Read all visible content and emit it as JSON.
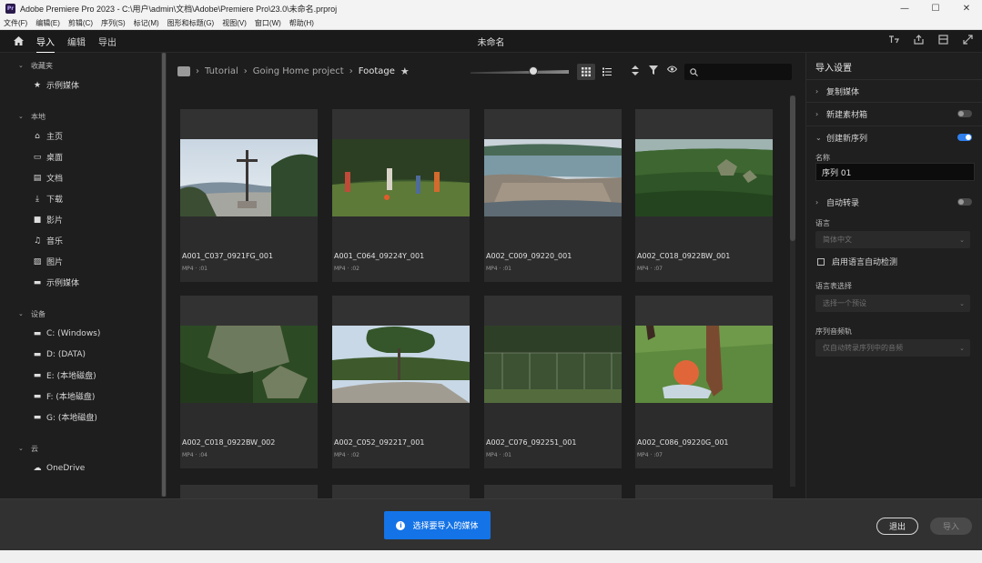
{
  "window": {
    "app_logo": "Pr",
    "title": "Adobe Premiere Pro 2023 - C:\\用户\\admin\\文档\\Adobe\\Premiere Pro\\23.0\\未命名.prproj",
    "minimize": "—",
    "maximize": "☐",
    "close": "✕"
  },
  "menu": [
    "文件(F)",
    "编辑(E)",
    "剪辑(C)",
    "序列(S)",
    "标记(M)",
    "图形和标题(G)",
    "视图(V)",
    "窗口(W)",
    "帮助(H)"
  ],
  "topbar": {
    "tabs": [
      {
        "label": "导入",
        "active": true
      },
      {
        "label": "编辑",
        "active": false
      },
      {
        "label": "导出",
        "active": false
      }
    ],
    "project_title": "未命名"
  },
  "sidebar": {
    "sections": [
      {
        "title": "收藏夹",
        "items": [
          {
            "icon": "star-icon",
            "label": "示例媒体"
          }
        ]
      },
      {
        "title": "本地",
        "items": [
          {
            "icon": "home-icon",
            "label": "主页"
          },
          {
            "icon": "desktop-icon",
            "label": "桌面"
          },
          {
            "icon": "document-icon",
            "label": "文档"
          },
          {
            "icon": "download-icon",
            "label": "下载"
          },
          {
            "icon": "video-icon",
            "label": "影片"
          },
          {
            "icon": "music-icon",
            "label": "音乐"
          },
          {
            "icon": "picture-icon",
            "label": "图片"
          },
          {
            "icon": "folder-icon",
            "label": "示例媒体"
          }
        ]
      },
      {
        "title": "设备",
        "items": [
          {
            "icon": "folder-icon",
            "label": "C: (Windows)"
          },
          {
            "icon": "folder-icon",
            "label": "D: (DATA)"
          },
          {
            "icon": "folder-icon",
            "label": "E: (本地磁盘)"
          },
          {
            "icon": "folder-icon",
            "label": "F: (本地磁盘)"
          },
          {
            "icon": "folder-icon",
            "label": "G: (本地磁盘)"
          }
        ]
      },
      {
        "title": "云",
        "items": [
          {
            "icon": "cloud-icon",
            "label": "OneDrive"
          }
        ]
      }
    ]
  },
  "browser": {
    "breadcrumb": [
      "Tutorial",
      "Going Home project",
      "Footage"
    ],
    "clips": [
      {
        "name": "A001_C037_0921FG_001",
        "meta": "MP4 · :01",
        "scene": "cross"
      },
      {
        "name": "A001_C064_09224Y_001",
        "meta": "MP4 · :02",
        "scene": "soccer"
      },
      {
        "name": "A002_C009_09220_001",
        "meta": "MP4 · :01",
        "scene": "town"
      },
      {
        "name": "A002_C018_0922BW_001",
        "meta": "MP4 · :07",
        "scene": "jungle"
      },
      {
        "name": "A002_C018_0922BW_002",
        "meta": "MP4 · :04",
        "scene": "ruins"
      },
      {
        "name": "A002_C052_092217_001",
        "meta": "MP4 · :02",
        "scene": "tree"
      },
      {
        "name": "A002_C076_092251_001",
        "meta": "MP4 · :01",
        "scene": "field"
      },
      {
        "name": "A002_C086_09220G_001",
        "meta": "MP4 · :07",
        "scene": "ball"
      }
    ]
  },
  "import_settings": {
    "title": "导入设置",
    "copy_media": "复制媒体",
    "create_bin": "新建素材箱",
    "create_sequence": "创建新序列",
    "name_label": "名称",
    "name_value": "序列 01",
    "auto_transcribe": "自动转录",
    "language_label": "语言",
    "language_value": "简体中文",
    "speaker_label": "启用语言自动检测",
    "preset_label": "语言表选择",
    "preset_value": "选择一个预设",
    "seq_label": "序列音频轨",
    "seq_value": "仅自动转录序列中的音频"
  },
  "footer": {
    "select_label": "选择要导入的媒体",
    "exit_label": "退出",
    "import_label": "导入"
  }
}
